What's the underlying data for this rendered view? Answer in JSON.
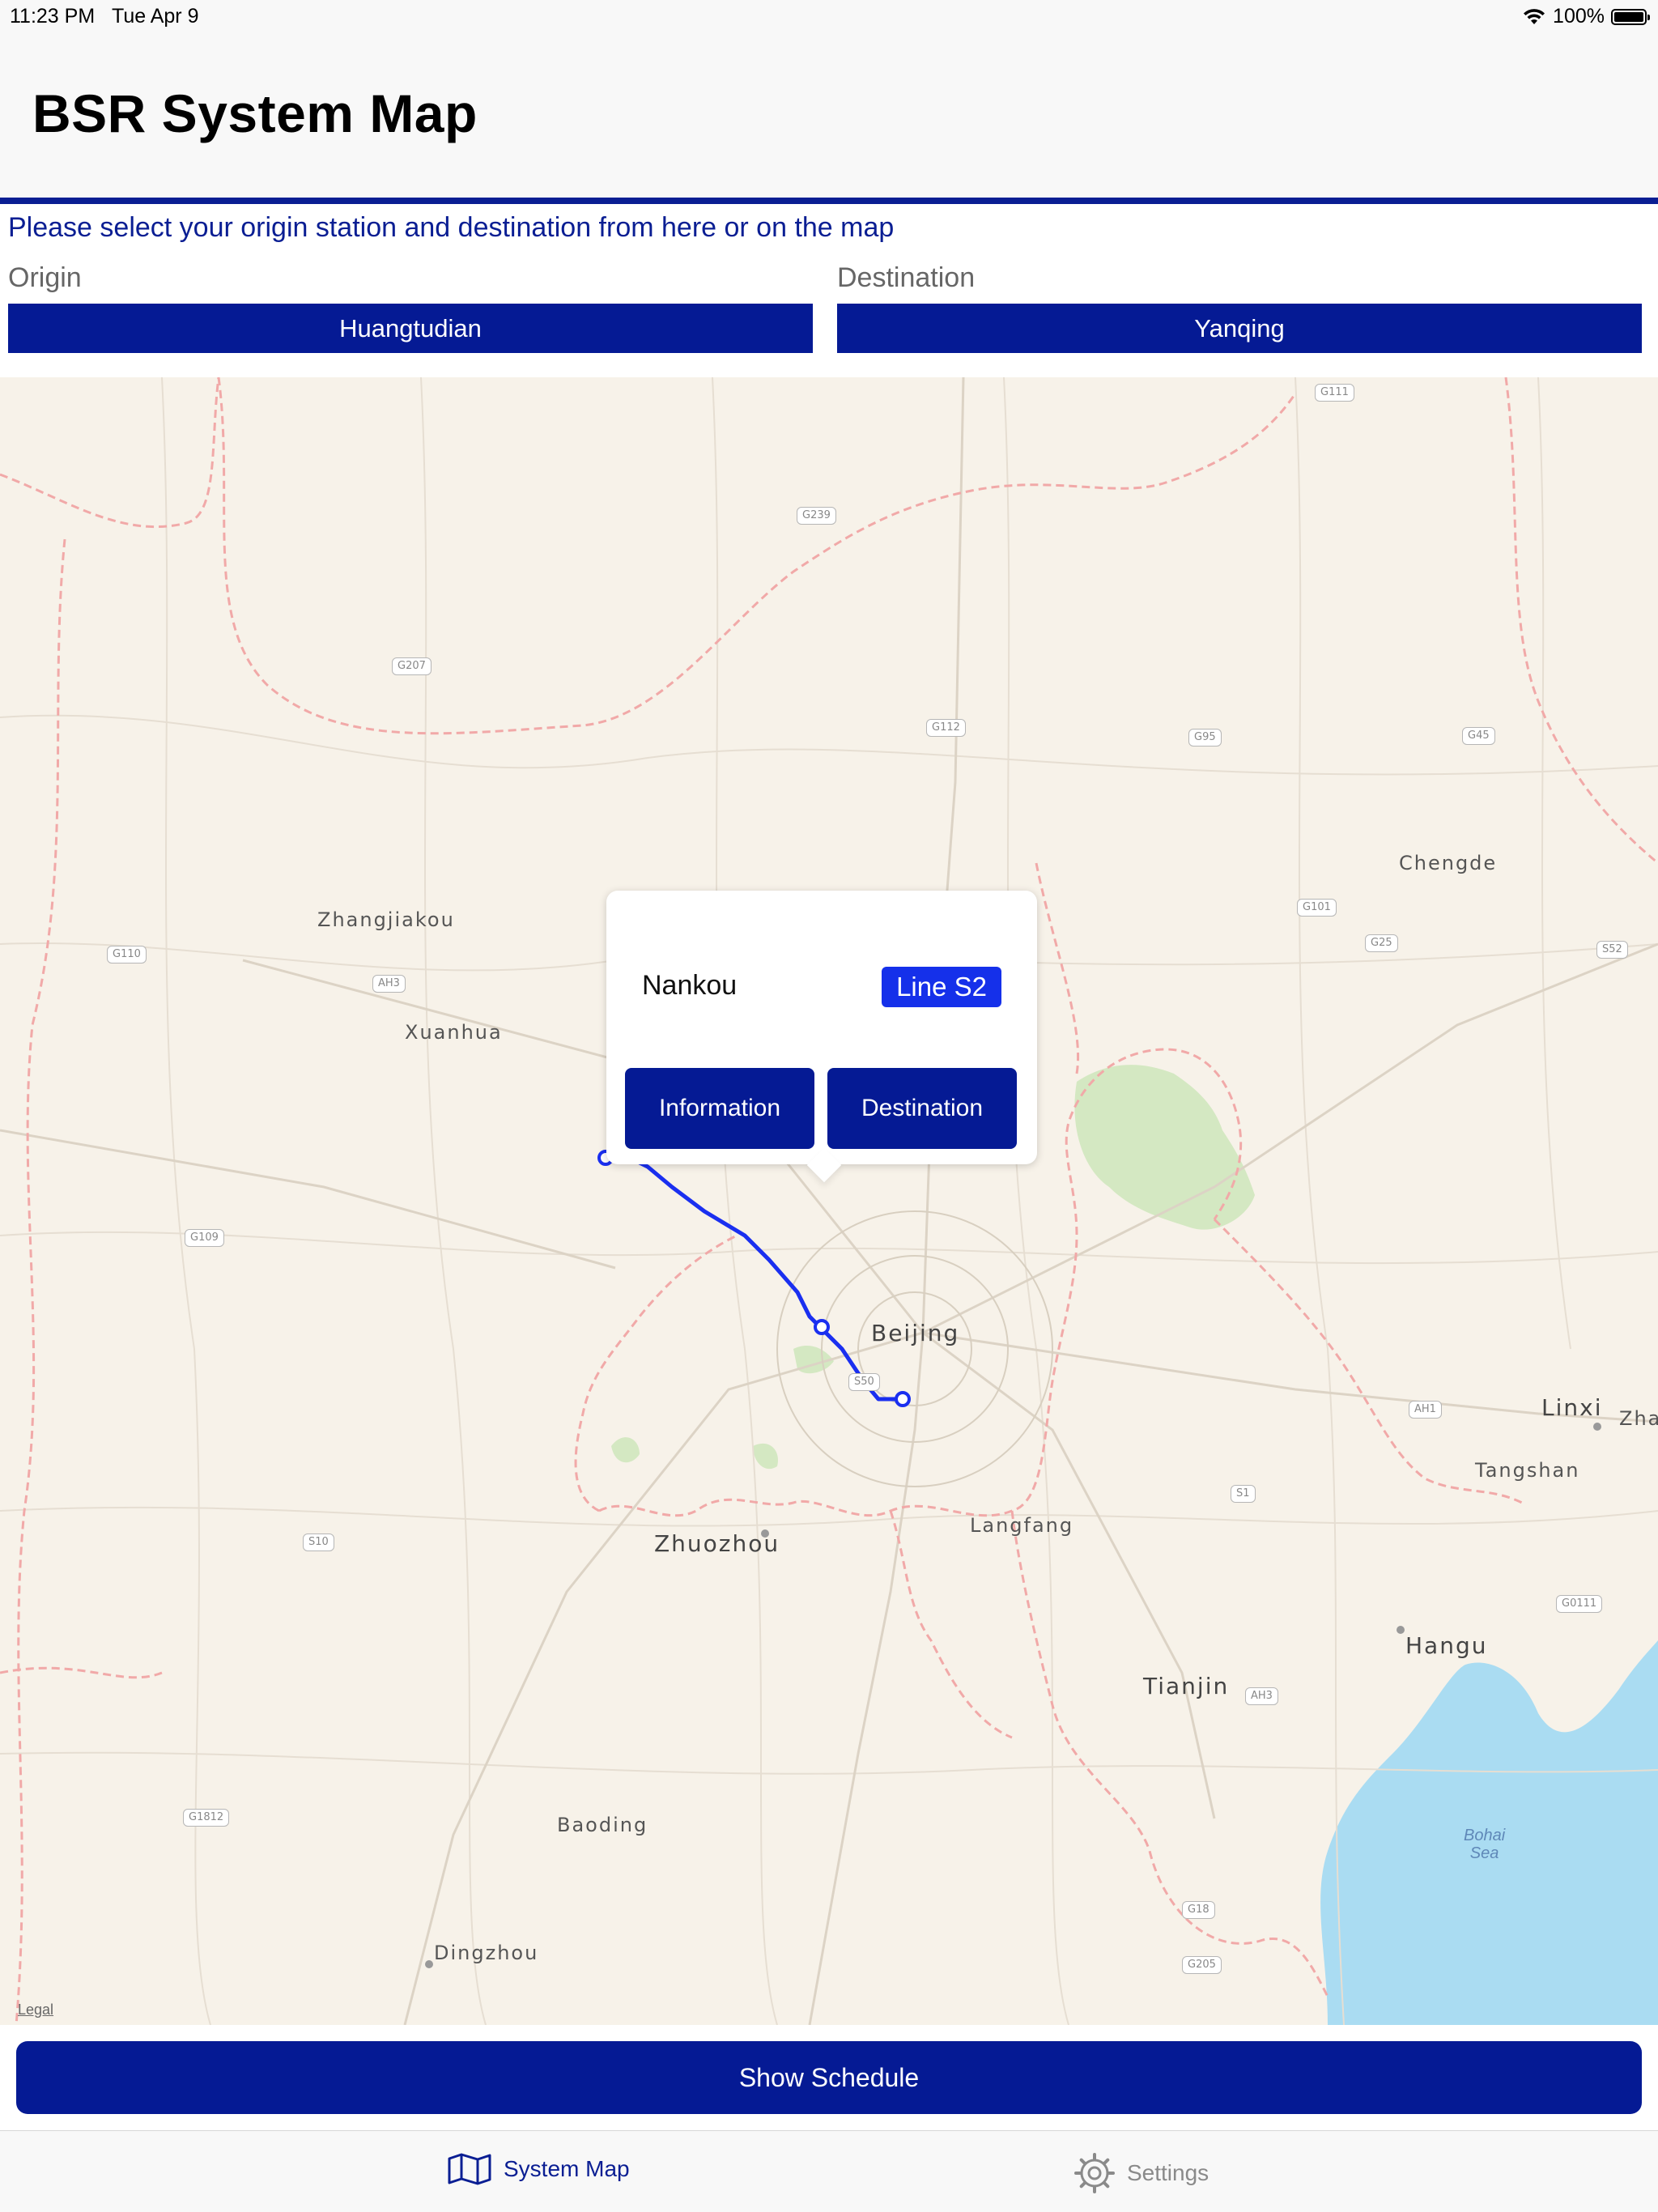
{
  "status_bar": {
    "time": "11:23 PM",
    "date": "Tue Apr 9",
    "battery": "100%"
  },
  "header": {
    "title": "BSR System Map"
  },
  "selection": {
    "instruction": "Please select your origin station and destination from here or on the map",
    "origin_label": "Origin",
    "origin_value": "Huangtudian",
    "destination_label": "Destination",
    "destination_value": "Yanqing"
  },
  "map": {
    "cities": {
      "zhangjiakou": "Zhangjiakou",
      "xuanhua": "Xuanhua",
      "chengde": "Chengde",
      "beijing": "Beijing",
      "linxi": "Linxi",
      "zha": "Zha",
      "tangshan": "Tangshan",
      "zhuozhou": "Zhuozhou",
      "langfang": "Langfang",
      "hangu": "Hangu",
      "tianjin": "Tianjin",
      "baoding": "Baoding",
      "dingzhou": "Dingzhou"
    },
    "sea_label_1": "Bohai",
    "sea_label_2": "Sea",
    "shields": {
      "g111": "G111",
      "g239": "G239",
      "g207": "G207",
      "g112": "G112",
      "g95": "G95",
      "g45": "G45",
      "g110": "G110",
      "ah3a": "AH3",
      "g101": "G101",
      "g25": "G25",
      "s52": "S52",
      "g109": "G109",
      "s50": "S50",
      "ah1": "AH1",
      "s1": "S1",
      "s10": "S10",
      "g0111": "G0111",
      "ah3b": "AH3",
      "g1812": "G1812",
      "g18": "G18",
      "g205": "G205"
    },
    "legal": "Legal",
    "route_color": "#1a2ff0",
    "water_color": "#aadcf2",
    "park_color": "#d4e8c2",
    "border_color": "#f1a9a8"
  },
  "callout": {
    "station": "Nankou",
    "line": "Line S2",
    "info_button": "Information",
    "destination_button": "Destination"
  },
  "schedule_button": "Show Schedule",
  "tab_bar": {
    "system_map": "System Map",
    "settings": "Settings"
  },
  "colors": {
    "brand": "#051a94",
    "accent": "#1530ea",
    "instruction_text": "#0a1e93"
  }
}
